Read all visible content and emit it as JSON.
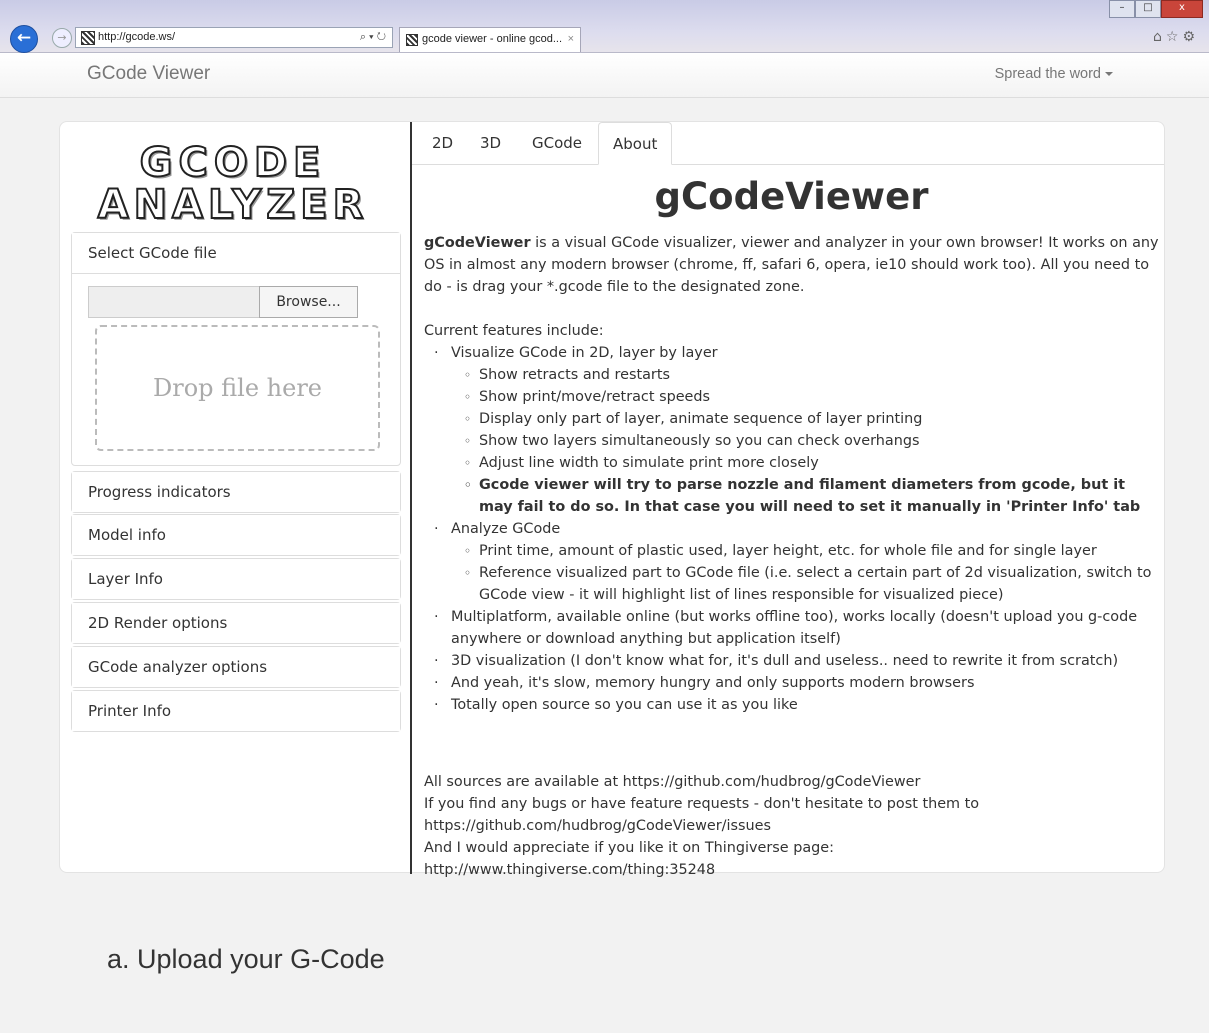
{
  "browser": {
    "url": "http://gcode.ws/",
    "address_tools": "⌕ ▾ ↻",
    "tab_title": "gcode viewer - online gcod...",
    "tab_close": "×",
    "back": "←",
    "forward": "→",
    "right_icons": "⌂☆⚙"
  },
  "navbar": {
    "brand": "GCode Viewer",
    "spread": "Spread the word"
  },
  "logo": {
    "line1": "GCODE",
    "line2": "ANALYZER"
  },
  "sidebar": {
    "select_file": "Select GCode file",
    "browse": "Browse...",
    "drop": "Drop file here",
    "panels": [
      "Progress indicators",
      "Model info",
      "Layer Info",
      "2D Render options",
      "GCode analyzer options",
      "Printer Info"
    ]
  },
  "tabs": [
    "2D",
    "3D",
    "GCode",
    "About"
  ],
  "about": {
    "title": "gCodeViewer",
    "intro_bold": "gCodeViewer",
    "intro_rest": " is a visual GCode visualizer, viewer and analyzer in your own browser! It works on any OS in almost any modern browser (chrome, ff, safari 6, opera, ie10 should work too). All you need to do - is drag your *.gcode file to the designated zone.",
    "features_heading": "Current features include:",
    "f1": "Visualize GCode in 2D, layer by layer",
    "f1_sub": [
      "Show retracts and restarts",
      "Show print/move/retract speeds",
      "Display only part of layer, animate sequence of layer printing",
      "Show two layers simultaneously so you can check overhangs",
      "Adjust line width to simulate print more closely"
    ],
    "f1_bold": "Gcode viewer will try to parse nozzle and filament diameters from gcode, but it may fail to do so. In that case you will need to set it manually in 'Printer Info' tab",
    "f2": "Analyze GCode",
    "f2_sub": [
      "Print time, amount of plastic used, layer height, etc. for whole file and for single layer",
      "Reference visualized part to GCode file (i.e. select a certain part of 2d visualization, switch to GCode view - it will highlight list of lines responsible for visualized piece)"
    ],
    "f3": "Multiplatform, available online (but works offline too), works locally (doesn't upload you g-code anywhere or download anything but application itself)",
    "f4": "3D visualization (I don't know what for, it's dull and useless.. need to rewrite it from scratch)",
    "f5": "And yeah, it's slow, memory hungry and only supports modern browsers",
    "f6": "Totally open source so you can use it as you like",
    "footer": [
      "All sources are available at https://github.com/hudbrog/gCodeViewer",
      "If you find any bugs or have feature requests - don't hesitate to post them to",
      "https://github.com/hudbrog/gCodeViewer/issues",
      "And I would appreciate if you like it on Thingiverse page:",
      "http://www.thingiverse.com/thing:35248"
    ]
  },
  "caption": "a.   Upload your G-Code"
}
